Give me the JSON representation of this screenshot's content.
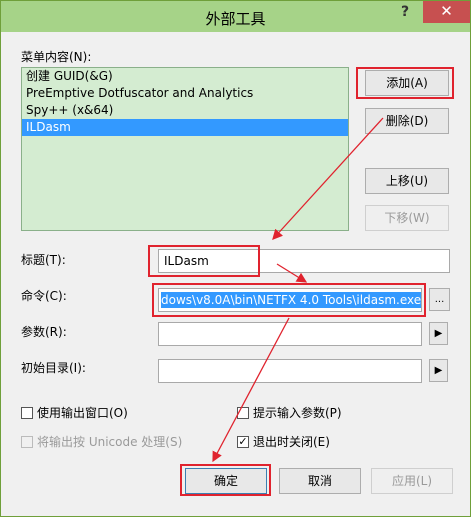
{
  "window": {
    "title": "外部工具",
    "help_label": "?",
    "close_label": "✕"
  },
  "menu_contents": {
    "label": "菜单内容(N):",
    "items": [
      {
        "label": "创建 GUID(&G)",
        "selected": false
      },
      {
        "label": "PreEmptive Dotfuscator and Analytics",
        "selected": false
      },
      {
        "label": "Spy++ (x&64)",
        "selected": false
      },
      {
        "label": "ILDasm",
        "selected": true
      }
    ]
  },
  "buttons": {
    "add": "添加(A)",
    "delete": "删除(D)",
    "move_up": "上移(U)",
    "move_down": "下移(W)",
    "ok": "确定",
    "cancel": "取消",
    "apply": "应用(L)"
  },
  "fields": {
    "title_label": "标题(T):",
    "title_value": "ILDasm",
    "command_label": "命令(C):",
    "command_value": "dows\\v8.0A\\bin\\NETFX 4.0 Tools\\ildasm.exe",
    "browse_label": "...",
    "arguments_label": "参数(R):",
    "arguments_value": "",
    "initial_dir_label": "初始目录(I):",
    "initial_dir_value": "",
    "arrow_label": "▶"
  },
  "checkboxes": {
    "use_output_window": {
      "label": "使用输出窗口(O)",
      "checked": false
    },
    "prompt_arguments": {
      "label": "提示输入参数(P)",
      "checked": false
    },
    "treat_output_unicode": {
      "label": "将输出按 Unicode 处理(S)",
      "checked": false
    },
    "close_on_exit": {
      "label": "退出时关闭(E)",
      "checked": true
    }
  },
  "colors": {
    "titlebar": "#a6d388",
    "annotation_red": "#e0232e",
    "selection": "#3399ff",
    "close": "#c75050"
  }
}
